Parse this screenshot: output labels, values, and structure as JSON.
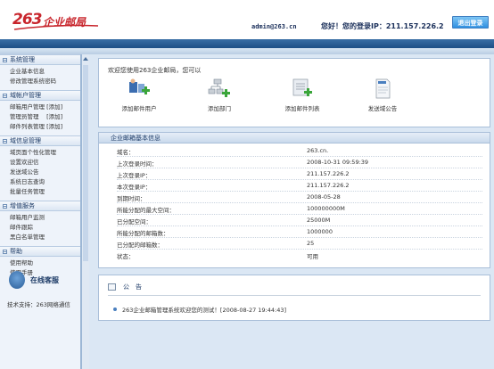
{
  "header": {
    "logo_num": "263",
    "logo_text": "企业邮局",
    "user_email": "admin@263.cn",
    "greeting": "您好！您的登录IP：211.157.226.2",
    "logout_label": "退出登录"
  },
  "sidebar": {
    "sections": [
      {
        "title": "系统管理",
        "items": [
          "企业基本信息",
          "修改管理系统密码"
        ]
      },
      {
        "title": "域帐户管理",
        "items": [
          "邮箱用户管理 [添加]",
          "管理员管理　 [添加]",
          "邮件列表管理 [添加]"
        ]
      },
      {
        "title": "域信息管理",
        "items": [
          "域页面个性化管理",
          "设置欢迎信",
          "发送域公告",
          "系统日志查询",
          "批量任务管理"
        ]
      },
      {
        "title": "增值服务",
        "items": [
          "邮箱用户监测",
          "邮件跟踪",
          "黑白名单管理"
        ]
      },
      {
        "title": "帮助",
        "items": [
          "使用帮助",
          "使用手册"
        ]
      }
    ],
    "service_label": "在线客服",
    "support_text": "技术支持：263网络通信"
  },
  "welcome": {
    "title": "欢迎您使用263企业邮局，您可以",
    "actions": [
      {
        "label": "添加邮件用户",
        "icon": "add-user-icon"
      },
      {
        "label": "添加部门",
        "icon": "add-department-icon"
      },
      {
        "label": "添加邮件列表",
        "icon": "add-list-icon"
      },
      {
        "label": "发送域公告",
        "icon": "notice-doc-icon"
      }
    ]
  },
  "info": {
    "title": "企业邮箱基本信息",
    "rows": [
      {
        "key": "域名：",
        "value": "263.cn."
      },
      {
        "key": "上次登录时间：",
        "value": "2008-10-31 09:59:39"
      },
      {
        "key": "上次登录IP：",
        "value": "211.157.226.2"
      },
      {
        "key": "本次登录IP：",
        "value": "211.157.226.2"
      },
      {
        "key": "到期时间：",
        "value": "2008-05-28"
      },
      {
        "key": "所能分配的最大空间：",
        "value": "100000000M"
      },
      {
        "key": "已分配空间：",
        "value": "25000M"
      },
      {
        "key": "所能分配的邮箱数：",
        "value": "1000000"
      },
      {
        "key": "已分配的邮箱数：",
        "value": "25"
      },
      {
        "key": "状态：",
        "value": "可用"
      }
    ]
  },
  "notice": {
    "title": "公　告",
    "item": "263企业邮箱管理系统欢迎您的测试！[2008-08-27 19:44:43]"
  },
  "colors": {
    "brand_red": "#c8252c",
    "nav_blue": "#1e4f86",
    "panel_bg": "#dbe7f4"
  }
}
